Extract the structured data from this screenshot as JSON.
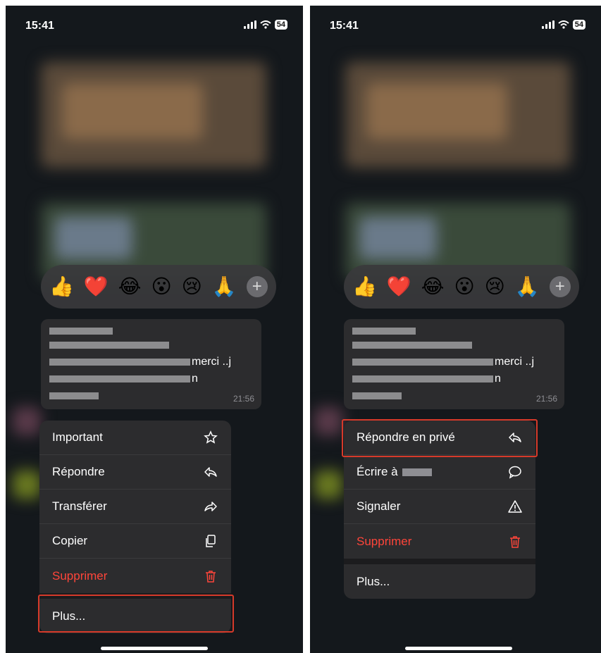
{
  "status": {
    "time": "15:41",
    "battery": "54"
  },
  "reactions": {
    "emojis": [
      "👍",
      "❤️",
      "😂",
      "😮",
      "😢",
      "🙏"
    ],
    "more_label": "+"
  },
  "message": {
    "visible_text_line1": "merci ..j",
    "visible_text_line2": "n",
    "time": "21:56"
  },
  "left_menu": {
    "items": [
      {
        "label": "Important",
        "icon": "star-icon"
      },
      {
        "label": "Répondre",
        "icon": "reply-icon"
      },
      {
        "label": "Transférer",
        "icon": "forward-icon"
      },
      {
        "label": "Copier",
        "icon": "copy-icon"
      },
      {
        "label": "Supprimer",
        "icon": "trash-icon"
      }
    ],
    "more_label": "Plus..."
  },
  "right_menu": {
    "items": [
      {
        "label": "Répondre en privé",
        "icon": "reply-icon"
      },
      {
        "label": "Écrire à",
        "icon": "chat-bubble-icon"
      },
      {
        "label": "Signaler",
        "icon": "warning-icon"
      },
      {
        "label": "Supprimer",
        "icon": "trash-icon"
      }
    ],
    "more_label": "Plus..."
  },
  "colors": {
    "destructive": "#ff453a",
    "highlight": "#d63a2a",
    "menu_bg": "#2c2c2e"
  }
}
